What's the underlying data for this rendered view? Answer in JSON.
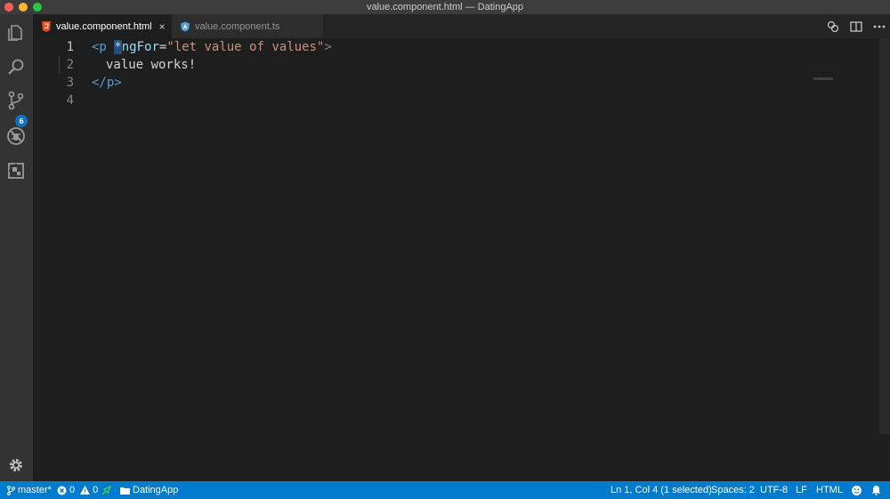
{
  "window": {
    "title": "value.component.html — DatingApp"
  },
  "activity_bar": {
    "items": [
      {
        "icon": "files-icon"
      },
      {
        "icon": "search-icon"
      },
      {
        "icon": "source-control-icon",
        "badge": "6"
      },
      {
        "icon": "debug-icon"
      },
      {
        "icon": "extensions-icon"
      }
    ],
    "settings_icon": "gear-icon"
  },
  "tabs": [
    {
      "label": "value.component.html",
      "icon": "html-file-icon",
      "active": true,
      "close": "×"
    },
    {
      "label": "value.component.ts",
      "icon": "angular-file-icon",
      "active": false
    }
  ],
  "editor_actions": [
    "open-changes-icon",
    "split-editor-icon",
    "more-icon"
  ],
  "editor": {
    "line_numbers": [
      "1",
      "2",
      "3",
      "4"
    ],
    "line1": {
      "open": "<p",
      "selected": "*",
      "attr": "ngFor",
      "eq": "=",
      "value": "\"let value of values\"",
      "close": ">"
    },
    "line2": {
      "text": "value works!"
    },
    "line3": {
      "close_tag": "</p>"
    },
    "line4": {
      "text": ""
    }
  },
  "status_bar": {
    "branch": "master*",
    "errors": "0",
    "warnings": "0",
    "folder": "DatingApp",
    "position": "Ln 1, Col 4 (1 selected)",
    "spaces": "Spaces: 2",
    "encoding": "UTF-8",
    "eol": "LF",
    "language": "HTML"
  },
  "colors": {
    "accent": "#007acc",
    "tag": "#569cd6",
    "attribute": "#9cdcfe",
    "string": "#ce9178",
    "html_icon": "#e44d26",
    "angular_icon": "#4d9eda"
  }
}
